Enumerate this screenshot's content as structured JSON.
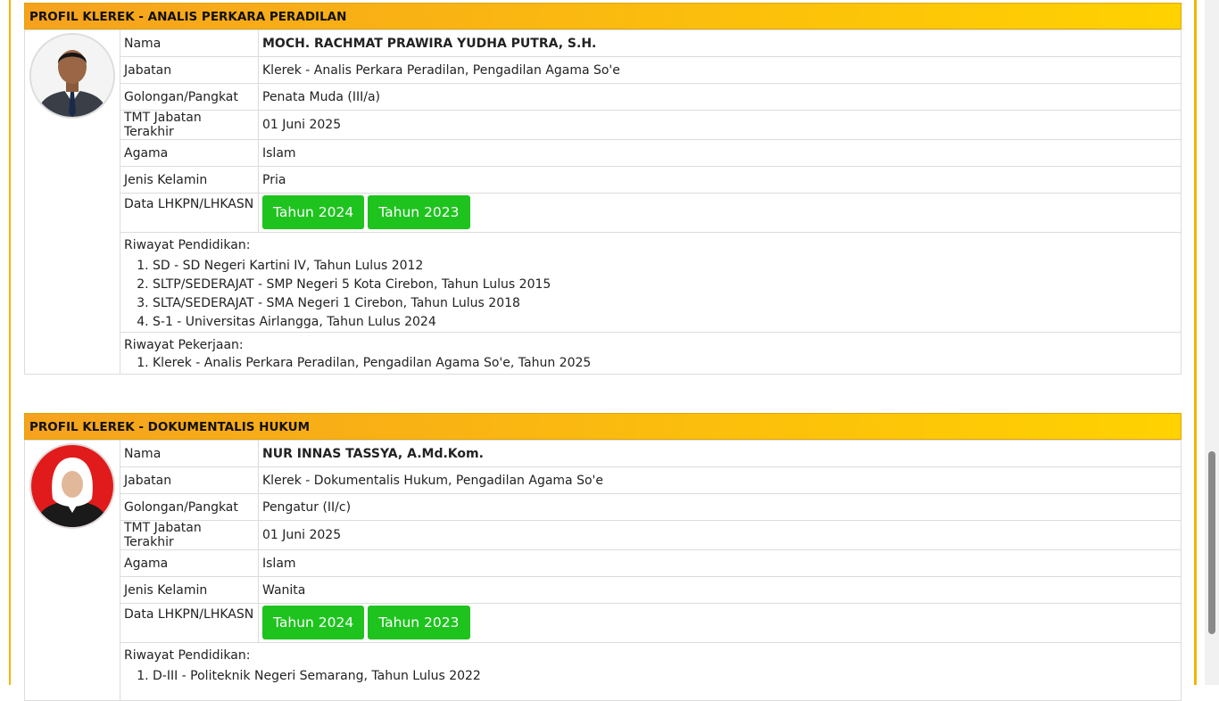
{
  "profiles": [
    {
      "header": "PROFIL KLEREK - ANALIS PERKARA PERADILAN",
      "photo_icon": "person-photo-male",
      "labels": {
        "nama": "Nama",
        "jabatan": "Jabatan",
        "golongan": "Golongan/Pangkat",
        "tmt": "TMT Jabatan Terakhir",
        "agama": "Agama",
        "jk": "Jenis Kelamin",
        "lhkpn": "Data LHKPN/LHKASN"
      },
      "values": {
        "nama": "MOCH. RACHMAT PRAWIRA YUDHA PUTRA, S.H.",
        "jabatan": "Klerek - Analis Perkara Peradilan, Pengadilan Agama So'e",
        "golongan": "Penata Muda (III/a)",
        "tmt": "01 Juni 2025",
        "agama": "Islam",
        "jk": "Pria"
      },
      "buttons": [
        "Tahun 2024",
        "Tahun 2023"
      ],
      "pendidikan_title": "Riwayat Pendidikan:",
      "pendidikan": [
        "SD - SD Negeri Kartini IV, Tahun Lulus 2012",
        "SLTP/SEDERAJAT - SMP Negeri 5 Kota Cirebon, Tahun Lulus 2015",
        "SLTA/SEDERAJAT - SMA Negeri 1 Cirebon, Tahun Lulus 2018",
        "S-1 - Universitas Airlangga, Tahun Lulus 2024"
      ],
      "pekerjaan_title": "Riwayat Pekerjaan:",
      "pekerjaan": [
        "Klerek - Analis Perkara Peradilan, Pengadilan Agama So'e, Tahun 2025"
      ]
    },
    {
      "header": "PROFIL KLEREK - DOKUMENTALIS HUKUM",
      "photo_icon": "person-photo-female",
      "labels": {
        "nama": "Nama",
        "jabatan": "Jabatan",
        "golongan": "Golongan/Pangkat",
        "tmt": "TMT Jabatan Terakhir",
        "agama": "Agama",
        "jk": "Jenis Kelamin",
        "lhkpn": "Data LHKPN/LHKASN"
      },
      "values": {
        "nama": "NUR INNAS TASSYA, A.Md.Kom.",
        "jabatan": "Klerek - Dokumentalis Hukum, Pengadilan Agama So'e",
        "golongan": "Pengatur (II/c)",
        "tmt": "01 Juni 2025",
        "agama": "Islam",
        "jk": "Wanita"
      },
      "buttons": [
        "Tahun 2024",
        "Tahun 2023"
      ],
      "pendidikan_title": "Riwayat Pendidikan:",
      "pendidikan": [
        "D-III - Politeknik Negeri Semarang, Tahun Lulus 2022"
      ]
    }
  ],
  "colors": {
    "header_start": "#f6a21e",
    "header_end": "#ffd200",
    "button": "#1ec31e",
    "frame": "#f5b400"
  }
}
